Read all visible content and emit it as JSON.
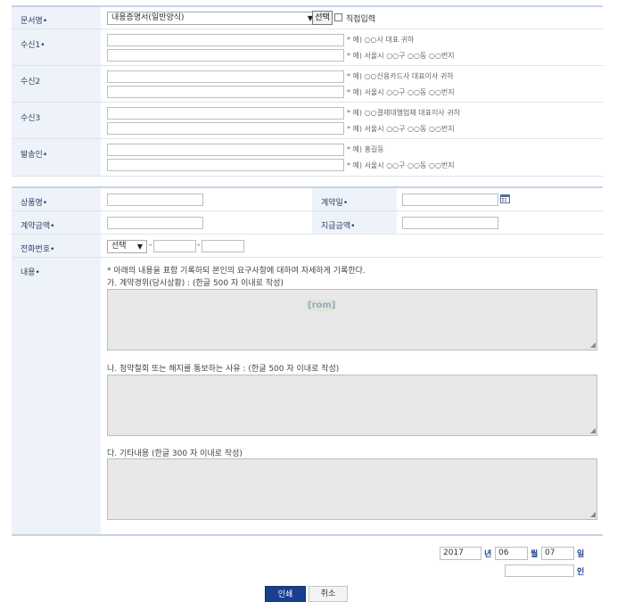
{
  "section1": {
    "doc": {
      "label": "문서명•",
      "select_value": "내용증명서(일반양식)",
      "choose_button": "선택",
      "direct_input_label": "직접입력"
    },
    "recipient1": {
      "label": "수신1•",
      "hint1": "* 예) ○○사 대표 귀하",
      "hint2": "* 예) 서울시 ○○구 ○○동 ○○번지"
    },
    "recipient2": {
      "label": "수신2",
      "hint1": "* 예) ○○신용카드사 대표이사 귀하",
      "hint2": "* 예) 서울시 ○○구 ○○동 ○○번지"
    },
    "recipient3": {
      "label": "수신3",
      "hint1": "* 예) ○○결재대행업체 대표이사 귀하",
      "hint2": "* 예) 서울시 ○○구 ○○동 ○○번지"
    },
    "sender": {
      "label": "발송인•",
      "hint1": "* 예) 홍길동",
      "hint2": "* 예) 서울시 ○○구 ○○동 ○○번지"
    }
  },
  "section2": {
    "product_label": "상품명•",
    "contract_date_label": "계약일•",
    "contract_amount_label": "계약금액•",
    "payment_amount_label": "지급금액•",
    "phone_label": "전화번호•",
    "phone_select": "선택",
    "phone_dash": "-",
    "content_label": "내용•",
    "content_note": "* 아래의 내용을 표함 기록하되 본인의 요구사항에 대하여 자세하게 기록한다.",
    "part_a": "가. 계약경위(당시상황) : (한글 500 자 이내로 작성)",
    "part_a_overlay": "[rom]",
    "part_b": "나. 청약철회 또는 해지를 통보하는 사유 : (한글 500 자 이내로 작성)",
    "part_c": "다. 기타내용 (한글 300 자 이내로 작성)"
  },
  "footer": {
    "year": "2017",
    "year_unit": "년",
    "month": "06",
    "month_unit": "월",
    "day": "07",
    "day_unit": "일",
    "seal_unit": "인",
    "print_button": "인쇄",
    "cancel_button": "취소"
  },
  "colors": {
    "label_bg": "#eef3fa",
    "label_text": "#2b3f66",
    "primary_button": "#1b3f8f",
    "day_text": "#1b3f8f"
  }
}
